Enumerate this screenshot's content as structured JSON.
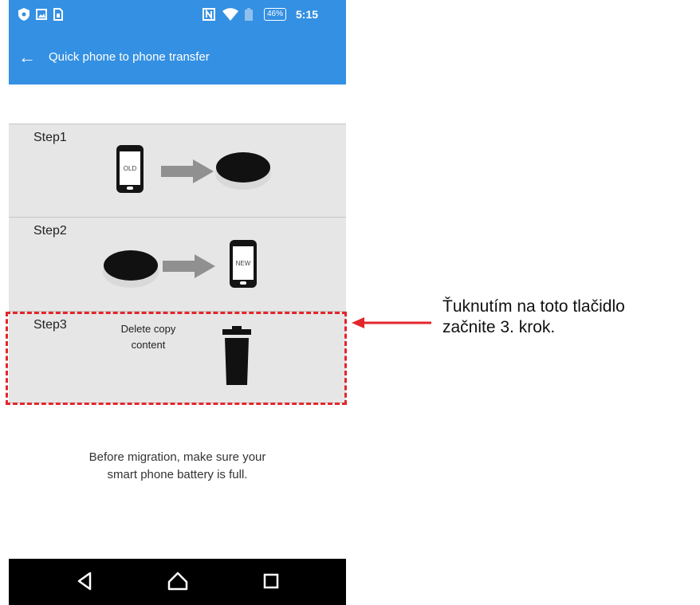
{
  "status_bar": {
    "battery_percent": "46%",
    "time": "5:15",
    "icons": [
      "shield-icon",
      "image-icon",
      "sim-icon",
      "nfc-icon",
      "wifi-icon",
      "battery-icon"
    ]
  },
  "app_bar": {
    "title": "Quick phone to phone transfer",
    "back_icon": "back-arrow-icon"
  },
  "steps": [
    {
      "label": "Step1",
      "phone_label": "OLD"
    },
    {
      "label": "Step2",
      "phone_label": "NEW"
    },
    {
      "label": "Step3",
      "text": "Delete copy content",
      "icon": "trash-icon"
    }
  ],
  "notice": {
    "line1": "Before migration, make sure your",
    "line2": "smart phone battery is full."
  },
  "nav_bar": {
    "buttons": [
      "back-triangle-icon",
      "home-icon",
      "recents-icon"
    ]
  },
  "annotation": {
    "line1": "Ťuknutím na toto tlačidlo",
    "line2": "začnite 3. krok.",
    "highlight_color": "#e3262b"
  },
  "colors": {
    "app_bar": "#3490e3",
    "step_background": "#e6e6e6",
    "nav_bar": "#000000"
  }
}
